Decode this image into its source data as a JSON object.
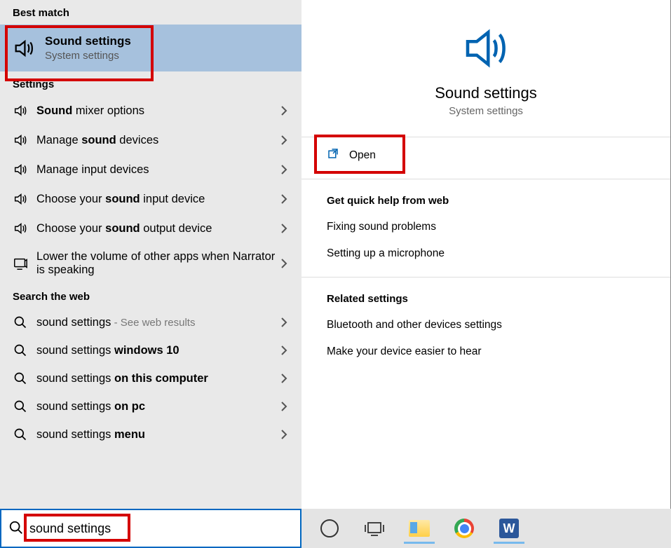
{
  "left": {
    "best_match_label": "Best match",
    "best_match": {
      "title": "Sound settings",
      "subtitle": "System settings"
    },
    "settings_label": "Settings",
    "settings_items": [
      {
        "pre": "",
        "bold": "Sound",
        "post": " mixer options",
        "icon": "speaker"
      },
      {
        "pre": "Manage ",
        "bold": "sound",
        "post": " devices",
        "icon": "speaker"
      },
      {
        "pre": "Manage input devices",
        "bold": "",
        "post": "",
        "icon": "speaker"
      },
      {
        "pre": "Choose your ",
        "bold": "sound",
        "post": " input device",
        "icon": "speaker"
      },
      {
        "pre": "Choose your ",
        "bold": "sound",
        "post": " output device",
        "icon": "speaker"
      },
      {
        "pre": "Lower the volume of other apps when Narrator is speaking",
        "bold": "",
        "post": "",
        "icon": "narrator"
      }
    ],
    "web_label": "Search the web",
    "web_items": [
      {
        "pre": "sound settings",
        "bold": "",
        "post": "",
        "suffix": " - See web results"
      },
      {
        "pre": "sound settings ",
        "bold": "windows 10",
        "post": "",
        "suffix": ""
      },
      {
        "pre": "sound settings ",
        "bold": "on this computer",
        "post": "",
        "suffix": ""
      },
      {
        "pre": "sound settings ",
        "bold": "on pc",
        "post": "",
        "suffix": ""
      },
      {
        "pre": "sound settings ",
        "bold": "menu",
        "post": "",
        "suffix": ""
      }
    ]
  },
  "right": {
    "hero_title": "Sound settings",
    "hero_sub": "System settings",
    "open_label": "Open",
    "quick_help_label": "Get quick help from web",
    "quick_help_items": [
      "Fixing sound problems",
      "Setting up a microphone"
    ],
    "related_label": "Related settings",
    "related_items": [
      "Bluetooth and other devices settings",
      "Make your device easier to hear"
    ]
  },
  "search": {
    "value": "sound settings"
  },
  "colors": {
    "accent": "#0063B1",
    "highlight": "#d40000"
  }
}
